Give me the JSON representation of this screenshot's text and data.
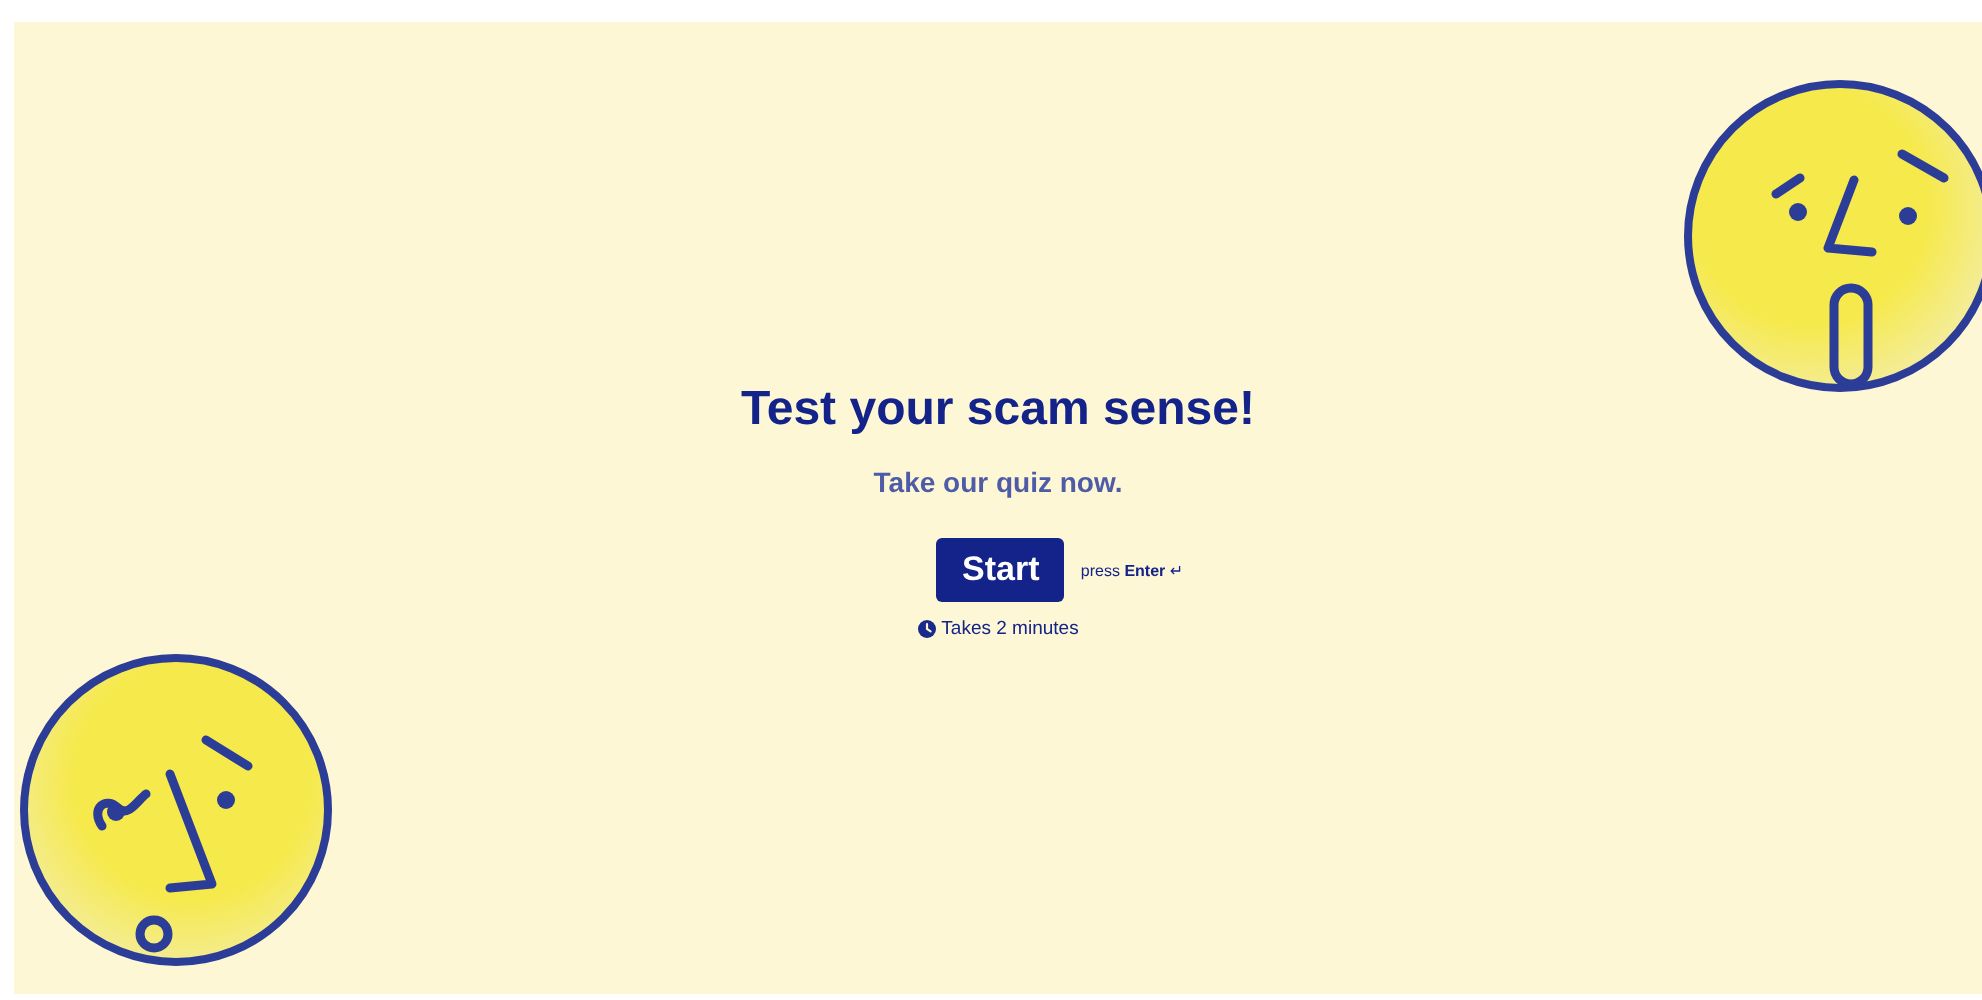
{
  "title": "Test your scam sense!",
  "subtitle": "Take our quiz now.",
  "start_button": {
    "label": "Start"
  },
  "hint": {
    "prefix": "press",
    "key": "Enter",
    "symbol": "↵"
  },
  "duration": "Takes 2 minutes"
}
